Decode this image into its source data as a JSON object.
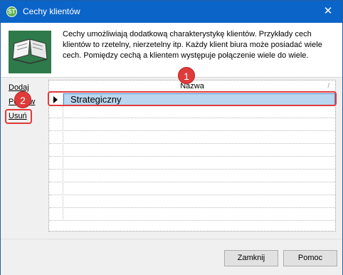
{
  "window": {
    "title": "Cechy klientów"
  },
  "description": "Cechy umożliwiają dodatkową charakterystykę klientów. Przykłady cech klientów to rzetelny, nierzetelny itp. Każdy klient biura może posiadać wiele cech. Pomiędzy cechą a klientem występuje połączenie wiele do wiele.",
  "actions": {
    "add": "Dodaj",
    "edit": "Popraw",
    "remove": "Usuń"
  },
  "grid": {
    "column": "Nazwa",
    "rows": [
      "Strategiczny"
    ]
  },
  "footer": {
    "close": "Zamknij",
    "help": "Pomoc"
  },
  "annotations": {
    "one": "1",
    "two": "2"
  },
  "colors": {
    "titlebar": "#0b64c8",
    "selection": "#b9d7f0",
    "callout": "#e03a3a"
  }
}
